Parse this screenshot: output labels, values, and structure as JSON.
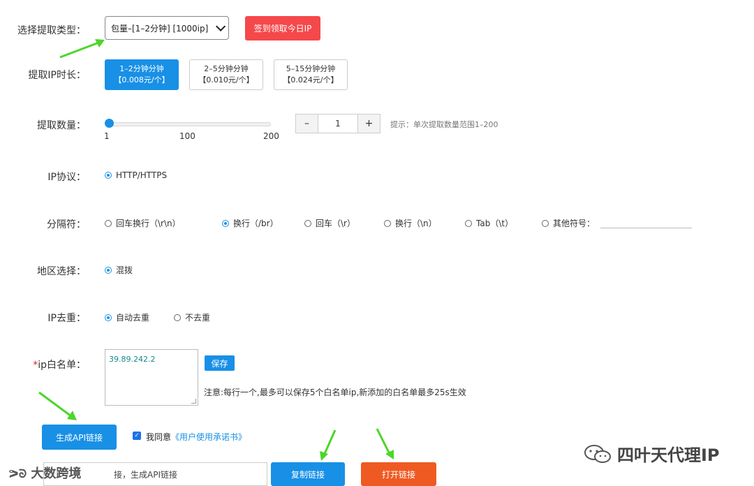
{
  "colors": {
    "primary": "#1890e6",
    "red": "#f5484a",
    "orange": "#ef5a23",
    "arrow": "#4cd62a"
  },
  "extract_type": {
    "label": "选择提取类型：",
    "selected": "包量–[1–2分钟] [1000ip]",
    "checkin_button": "签到领取今日IP"
  },
  "duration": {
    "label": "提取IP时长：",
    "options": [
      {
        "line1": "1–2分钟分钟",
        "line2": "【0.008元/个】",
        "active": true
      },
      {
        "line1": "2–5分钟分钟",
        "line2": "【0.010元/个】",
        "active": false
      },
      {
        "line1": "5–15分钟分钟",
        "line2": "【0.024元/个】",
        "active": false
      }
    ]
  },
  "quantity": {
    "label": "提取数量：",
    "slider_value": 1,
    "slider_min": "1",
    "slider_mid": "100",
    "slider_max": "200",
    "minus": "–",
    "plus": "+",
    "value": "1",
    "hint": "提示：单次提取数量范围1–200"
  },
  "protocol": {
    "label": "IP协议：",
    "options": [
      {
        "text": "HTTP/HTTPS",
        "checked": true
      }
    ]
  },
  "separator": {
    "label": "分隔符：",
    "options": [
      {
        "text": "回车换行（\\r\\n）",
        "checked": false
      },
      {
        "text": "换行（/br）",
        "checked": true
      },
      {
        "text": "回车（\\r）",
        "checked": false
      },
      {
        "text": "换行（\\n）",
        "checked": false
      },
      {
        "text": "Tab（\\t）",
        "checked": false
      },
      {
        "text": "其他符号：",
        "checked": false
      }
    ]
  },
  "region": {
    "label": "地区选择：",
    "options": [
      {
        "text": "混拨",
        "checked": true
      }
    ]
  },
  "dedup": {
    "label": "IP去重：",
    "options": [
      {
        "text": "自动去重",
        "checked": true
      },
      {
        "text": "不去重",
        "checked": false
      }
    ]
  },
  "whitelist": {
    "required_mark": "*",
    "label": "ip白名单：",
    "value": "39.89.242.2",
    "save_button": "保存",
    "note": "注意:每行一个,最多可以保存5个白名单ip,新添加的白名单最多25s生效"
  },
  "actions": {
    "generate_button": "生成API链接",
    "agree_text": "我同意",
    "agree_link": "《用户使用承诺书》",
    "link_placeholder": "接，生成API链接",
    "copy_button": "复制链接",
    "open_button": "打开链接"
  },
  "watermarks": {
    "left": "大数跨境",
    "right": "四叶天代理IP"
  }
}
